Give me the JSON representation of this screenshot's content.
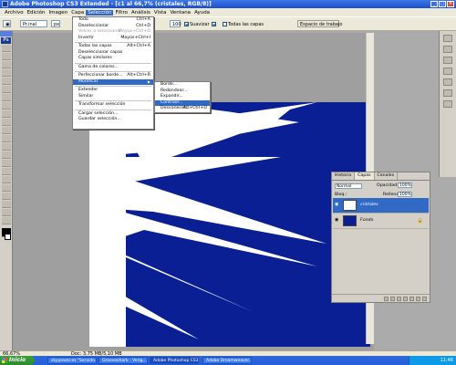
{
  "window": {
    "title": "Adobe Photoshop CS3 Extended - [c1 al 66,7% (cristales, RGB/8)]"
  },
  "menubar": [
    "Archivo",
    "Edición",
    "Imagen",
    "Capa",
    "Selección",
    "Filtro",
    "Análisis",
    "Vista",
    "Ventana",
    "Ayuda"
  ],
  "options": {
    "preset": "Pr.inal",
    "unit": "px",
    "suavizar_label": "Suavizar",
    "todas_capas_label": "Todas las capas",
    "workspace": "Espacio de trabajo"
  },
  "selection_menu": [
    {
      "label": "Todo",
      "shortcut": "Ctrl+A"
    },
    {
      "label": "Deseleccionar",
      "shortcut": "Ctrl+D"
    },
    {
      "label": "Volver a seleccionar",
      "shortcut": "Mayús+Ctrl+D",
      "dim": true
    },
    {
      "label": "Invertir",
      "shortcut": "Mayús+Ctrl+I"
    },
    {
      "sep": true
    },
    {
      "label": "Todas las capas",
      "shortcut": "Alt+Ctrl+A"
    },
    {
      "label": "Deseleccionar capas",
      "shortcut": ""
    },
    {
      "label": "Capas similares",
      "shortcut": ""
    },
    {
      "sep": true
    },
    {
      "label": "Gama de colores...",
      "shortcut": ""
    },
    {
      "sep": true
    },
    {
      "label": "Perfeccionar borde...",
      "shortcut": "Alt+Ctrl+R"
    },
    {
      "label": "Modificar",
      "shortcut": "",
      "submenu": true,
      "hl": true
    },
    {
      "sep": true
    },
    {
      "label": "Extender",
      "shortcut": ""
    },
    {
      "label": "Similar",
      "shortcut": ""
    },
    {
      "sep": true
    },
    {
      "label": "Transformar selección",
      "shortcut": ""
    },
    {
      "sep": true
    },
    {
      "label": "Cargar selección...",
      "shortcut": ""
    },
    {
      "label": "Guardar selección...",
      "shortcut": ""
    }
  ],
  "modify_submenu": [
    {
      "label": "Borde...",
      "shortcut": ""
    },
    {
      "label": "Redondear...",
      "shortcut": ""
    },
    {
      "label": "Expandir...",
      "shortcut": ""
    },
    {
      "label": "Contraer...",
      "shortcut": "",
      "hl": true
    },
    {
      "label": "Desvanecer...",
      "shortcut": "Alt+Ctrl+D"
    }
  ],
  "layers_panel": {
    "tabs": [
      "Historia",
      "Capas",
      "Canales"
    ],
    "active_tab": 1,
    "blend_mode": "Normal",
    "opacity_label": "Opacidad:",
    "opacity_value": "100%",
    "lock_label": "Bloq.:",
    "fill_label": "Relleno:",
    "fill_value": "100%",
    "layers": [
      {
        "name": "cristales",
        "selected": true
      },
      {
        "name": "Fondo",
        "selected": false,
        "locked": true
      }
    ]
  },
  "status": {
    "zoom": "66,67%",
    "doc": "Doc: 3,75 MB/5,10 MB"
  },
  "taskbar": {
    "start": "Inicio",
    "tasks": [
      "skypower.es \"Servido...",
      "Grooveshark - Verig...",
      "Adobe Photoshop CS3...",
      "Adobe Dreamweaver..."
    ],
    "active_task": 2,
    "clock": "11:46"
  },
  "colors": {
    "canvas_bg": "#091f93",
    "highlight": "#316ac5"
  }
}
